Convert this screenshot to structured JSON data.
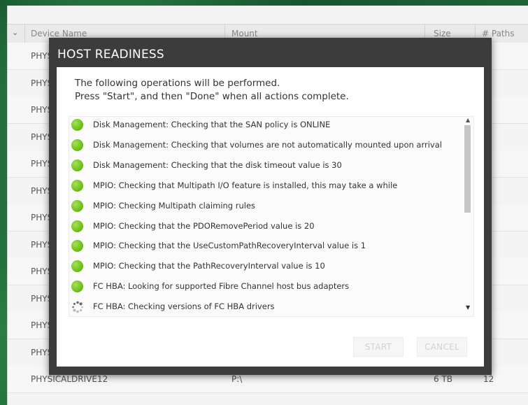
{
  "background_table": {
    "columns": {
      "device_name": "Device Name",
      "mount": "Mount",
      "size": "Size",
      "paths": "# Paths"
    },
    "rows": [
      {
        "name": "PHYS",
        "mount": "",
        "size": "",
        "paths": ""
      },
      {
        "name": "PHYS",
        "mount": "",
        "size": "",
        "paths": ""
      },
      {
        "name": "PHYS",
        "mount": "",
        "size": "",
        "paths": ""
      },
      {
        "name": "PHYS",
        "mount": "",
        "size": "",
        "paths": ""
      },
      {
        "name": "PHYS",
        "mount": "",
        "size": "",
        "paths": ""
      },
      {
        "name": "PHYS",
        "mount": "",
        "size": "",
        "paths": ""
      },
      {
        "name": "PHYS",
        "mount": "",
        "size": "",
        "paths": ""
      },
      {
        "name": "PHYS",
        "mount": "",
        "size": "",
        "paths": ""
      },
      {
        "name": "PHYS",
        "mount": "",
        "size": "",
        "paths": ""
      },
      {
        "name": "PHYS",
        "mount": "",
        "size": "",
        "paths": ""
      },
      {
        "name": "PHYS",
        "mount": "",
        "size": "",
        "paths": ""
      },
      {
        "name": "PHYS",
        "mount": "",
        "size": "",
        "paths": ""
      },
      {
        "name": "PHYSICALDRIVE12",
        "mount": "P:\\",
        "size": "6 TB",
        "paths": "12"
      }
    ]
  },
  "dialog": {
    "title": "HOST READINESS",
    "intro_line1": "The following operations will be performed.",
    "intro_line2": "Press \"Start\", and then \"Done\" when all actions complete.",
    "operations": [
      {
        "text": "Disk Management: Checking that the SAN policy is ONLINE",
        "status": "done"
      },
      {
        "text": "Disk Management: Checking that volumes are not automatically mounted upon arrival",
        "status": "done"
      },
      {
        "text": "Disk Management: Checking that the disk timeout value is 30",
        "status": "done"
      },
      {
        "text": "MPIO: Checking that Multipath I/O feature is installed, this may take a while",
        "status": "done"
      },
      {
        "text": "MPIO: Checking Multipath claiming rules",
        "status": "done"
      },
      {
        "text": "MPIO: Checking that the PDORemovePeriod value is 20",
        "status": "done"
      },
      {
        "text": "MPIO: Checking that the UseCustomPathRecoveryInterval value is 1",
        "status": "done"
      },
      {
        "text": "MPIO: Checking that the PathRecoveryInterval value is 10",
        "status": "done"
      },
      {
        "text": "FC HBA: Looking for supported Fibre Channel host bus adapters",
        "status": "done"
      },
      {
        "text": "FC HBA: Checking versions of FC HBA drivers",
        "status": "in-progress"
      }
    ],
    "start_label": "START",
    "cancel_label": "CANCEL"
  },
  "colors": {
    "done_green": "#6fbf1a",
    "dialog_frame": "#3c3c3c",
    "disabled_text": "#d2d2d2"
  }
}
